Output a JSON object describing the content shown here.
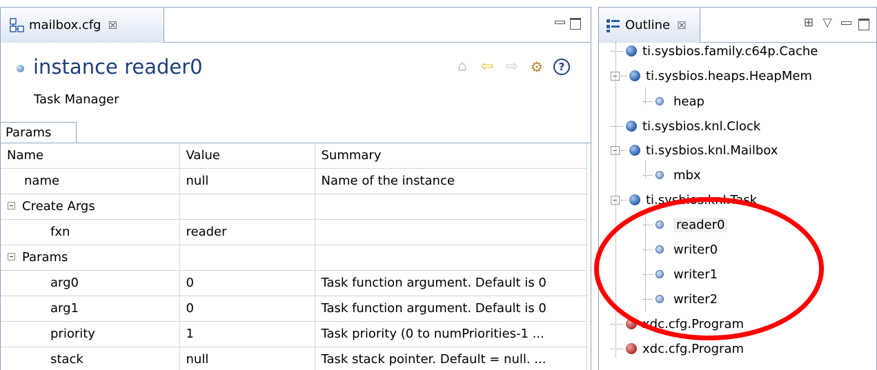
{
  "editor": {
    "tab_label": "mailbox.cfg",
    "tab_close": "☒",
    "instance_title": "instance reader0",
    "subtitle": "Task Manager",
    "params_tab": "Params",
    "columns": [
      "Name",
      "Value",
      "Summary"
    ],
    "rows": [
      {
        "name": "name",
        "value": "null",
        "summary": "Name of the instance",
        "kind": "field1"
      },
      {
        "name": "Create Args",
        "value": "",
        "summary": "",
        "kind": "group"
      },
      {
        "name": "fxn",
        "value": "reader",
        "summary": "",
        "kind": "field2"
      },
      {
        "name": "Params",
        "value": "",
        "summary": "",
        "kind": "group"
      },
      {
        "name": "arg0",
        "value": "0",
        "summary": "Task function argument. Default is 0",
        "kind": "field2"
      },
      {
        "name": "arg1",
        "value": "0",
        "summary": "Task function argument. Default is 0",
        "kind": "field2"
      },
      {
        "name": "priority",
        "value": "1",
        "summary": "Task priority (0 to numPriorities-1 ...",
        "kind": "field2"
      },
      {
        "name": "stack",
        "value": "null",
        "summary": "Task stack pointer. Default = null. ...",
        "kind": "field2"
      }
    ]
  },
  "outline": {
    "tab_label": "Outline",
    "tab_close": "☒",
    "items": [
      {
        "label": "ti.sysbios.family.c64p.Cache",
        "level": 0,
        "icon": "blue-ball",
        "expandable": false
      },
      {
        "label": "ti.sysbios.heaps.HeapMem",
        "level": 0,
        "icon": "blue-ball",
        "expandable": true
      },
      {
        "label": "heap",
        "level": 1,
        "icon": "blue-dot",
        "expandable": false
      },
      {
        "label": "ti.sysbios.knl.Clock",
        "level": 0,
        "icon": "blue-ball",
        "expandable": false
      },
      {
        "label": "ti.sysbios.knl.Mailbox",
        "level": 0,
        "icon": "blue-ball",
        "expandable": true
      },
      {
        "label": "mbx",
        "level": 1,
        "icon": "blue-dot",
        "expandable": false
      },
      {
        "label": "ti.sysbios.knl.Task",
        "level": 0,
        "icon": "blue-ball",
        "expandable": true
      },
      {
        "label": "reader0",
        "level": 1,
        "icon": "blue-dot",
        "expandable": false,
        "selected": true
      },
      {
        "label": "writer0",
        "level": 1,
        "icon": "blue-dot",
        "expandable": false
      },
      {
        "label": "writer1",
        "level": 1,
        "icon": "blue-dot",
        "expandable": false
      },
      {
        "label": "writer2",
        "level": 1,
        "icon": "blue-dot",
        "expandable": false
      },
      {
        "label": "xdc.cfg.Program",
        "level": 0,
        "icon": "red-ball",
        "expandable": false
      },
      {
        "label": "xdc.cfg.Program",
        "level": 0,
        "icon": "red-ball",
        "expandable": false
      }
    ]
  },
  "colors": {
    "title_blue": "#1f3f7a",
    "border_blue": "#8fa3bf",
    "highlight_red": "#ff0000"
  },
  "icons": [
    "config-file-icon",
    "home-icon",
    "back-arrow-icon",
    "forward-arrow-icon",
    "config-settings-icon",
    "help-icon",
    "outline-icon",
    "sort-icon",
    "view-menu-icon",
    "minimize-icon",
    "maximize-icon"
  ]
}
